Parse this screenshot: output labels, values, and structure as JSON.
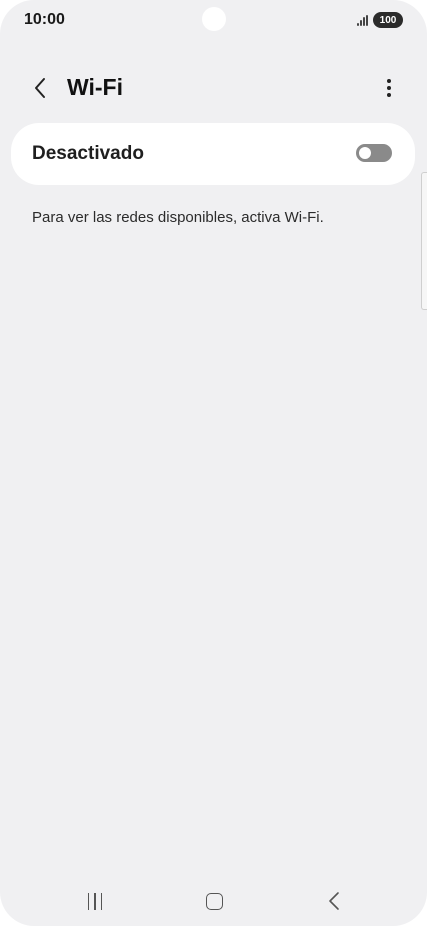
{
  "status_bar": {
    "time": "10:00",
    "battery": "100",
    "icons": [
      "signal-icon",
      "battery-icon"
    ]
  },
  "app_bar": {
    "title": "Wi-Fi",
    "back_icon": "chevron-left-icon",
    "more_icon": "more-vertical-icon"
  },
  "wifi_toggle": {
    "label": "Desactivado",
    "state": "off",
    "colors": {
      "track": "#8a8a8a",
      "knob": "#ffffff"
    }
  },
  "info_text": "Para ver las redes disponibles, activa Wi-Fi.",
  "nav_bar": {
    "icons": [
      "recents-icon",
      "home-icon",
      "back-icon"
    ]
  },
  "colors": {
    "background": "#f0f0f2",
    "card": "#ffffff",
    "text": "#1f1f1f"
  }
}
